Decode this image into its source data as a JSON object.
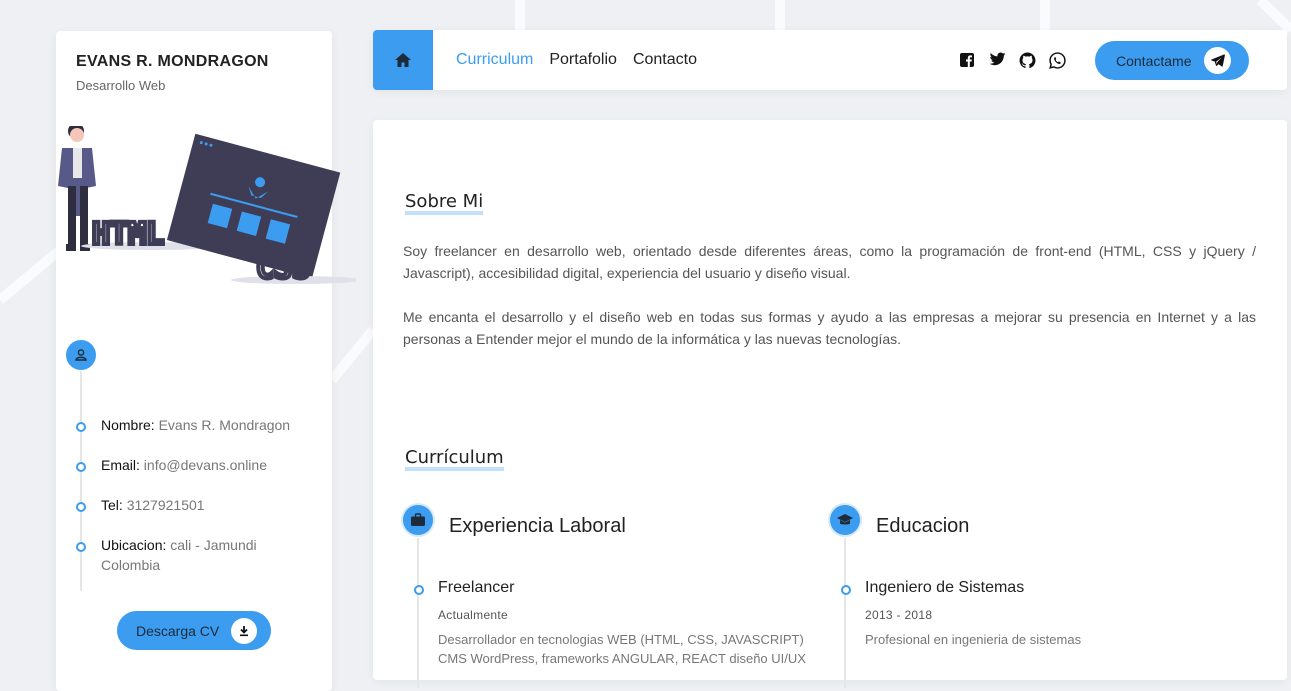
{
  "profile": {
    "name": "EVANS R. MONDRAGON",
    "role": "Desarrollo Web",
    "illustration_text": [
      "HTML",
      "CSS"
    ],
    "info": [
      {
        "label": "Nombre:",
        "value": "Evans R. Mondragon"
      },
      {
        "label": "Email:",
        "value": "info@devans.online"
      },
      {
        "label": "Tel:",
        "value": "3127921501"
      },
      {
        "label": "Ubicacion:",
        "value": "cali - Jamundi",
        "value2": "Colombia"
      }
    ],
    "download_label": "Descarga CV"
  },
  "nav": {
    "items": [
      "Curriculum",
      "Portafolio",
      "Contacto"
    ],
    "active": "Curriculum",
    "social_icons": [
      "facebook-icon",
      "twitter-icon",
      "github-icon",
      "whatsapp-icon"
    ],
    "contact_label": "Contactame"
  },
  "about": {
    "title": "Sobre Mi",
    "paragraphs": [
      "Soy freelancer en desarrollo web, orientado desde diferentes áreas, como la programación de front-end (HTML, CSS y jQuery / Javascript), accesibilidad digital, experiencia del usuario y diseño visual.",
      "Me encanta el desarrollo y el diseño web en todas sus formas y ayudo a las empresas a mejorar su presencia en Internet y a las personas a Entender mejor el mundo de la informática y las nuevas tecnologías."
    ]
  },
  "curriculum": {
    "title": "Currículum",
    "experience": {
      "title": "Experiencia Laboral",
      "entries": [
        {
          "title": "Freelancer",
          "period": "Actualmente",
          "desc": "Desarrollador en tecnologias WEB (HTML, CSS, JAVASCRIPT) CMS WordPress, frameworks ANGULAR, REACT diseño UI/UX"
        }
      ]
    },
    "education": {
      "title": "Educacion",
      "entries": [
        {
          "title": "Ingeniero de Sistemas",
          "period": "2013 - 2018",
          "desc": "Profesional en ingenieria de sistemas"
        }
      ]
    }
  },
  "colors": {
    "accent": "#3b9cf0",
    "accent_light": "#a9d3f7",
    "dark_shape": "#3f3d56"
  }
}
